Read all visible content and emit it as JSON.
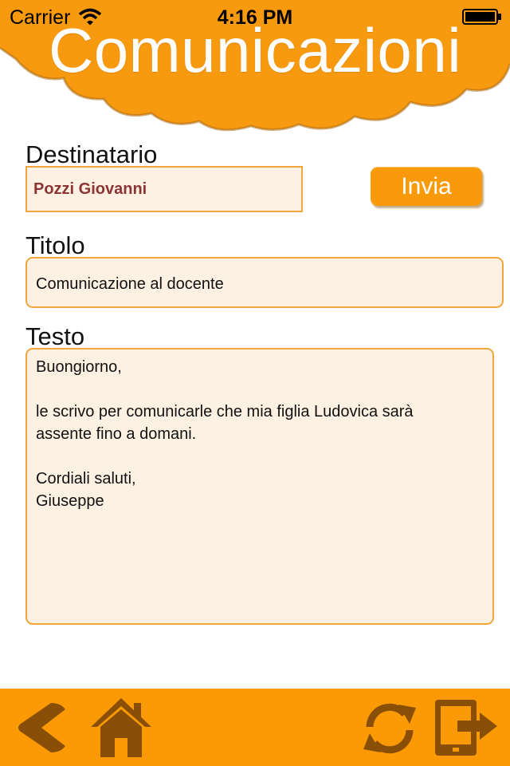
{
  "status_bar": {
    "carrier": "Carrier",
    "time": "4:16 PM"
  },
  "header": {
    "title": "Comunicazioni"
  },
  "form": {
    "recipient": {
      "label": "Destinatario",
      "value": "Pozzi Giovanni"
    },
    "send_label": "Invia",
    "subject": {
      "label": "Titolo",
      "value": "Comunicazione al docente"
    },
    "body": {
      "label": "Testo",
      "value": "Buongiorno,\n\nle scrivo per comunicarle che mia figlia Ludovica sarà\nassente fino a domani.\n\nCordiali saluti,\nGiuseppe"
    }
  },
  "toolbar": {
    "icons": [
      "back-icon",
      "home-icon",
      "refresh-icon",
      "logout-icon"
    ]
  },
  "colors": {
    "accent": "#fb9a05",
    "field_background": "#fdf1e4",
    "field_border": "#f0a63b",
    "recipient_text": "#8c3434"
  }
}
